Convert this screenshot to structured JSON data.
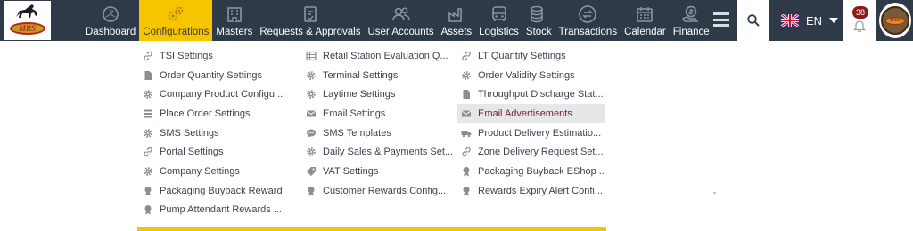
{
  "brand": {
    "logo_text": "MRS"
  },
  "nav": {
    "items": [
      {
        "label": "Dashboard",
        "icon": "gauge-icon",
        "active": false
      },
      {
        "label": "Configurations",
        "icon": "gears-icon",
        "active": true
      },
      {
        "label": "Masters",
        "icon": "building-icon",
        "active": false
      },
      {
        "label": "Requests & Approvals",
        "icon": "document-check-icon",
        "active": false
      },
      {
        "label": "User Accounts",
        "icon": "users-icon",
        "active": false
      },
      {
        "label": "Assets",
        "icon": "factory-icon",
        "active": false
      },
      {
        "label": "Logistics",
        "icon": "truck-icon",
        "active": false
      },
      {
        "label": "Stock",
        "icon": "coins-stack-icon",
        "active": false
      },
      {
        "label": "Transactions",
        "icon": "exchange-icon",
        "active": false
      },
      {
        "label": "Calendar",
        "icon": "calendar-icon",
        "active": false
      },
      {
        "label": "Finance",
        "icon": "money-hand-icon",
        "active": false
      }
    ]
  },
  "header": {
    "language": "EN",
    "notification_count": "38"
  },
  "colors": {
    "topbar": "#2f3a48",
    "accent": "#f6c500",
    "highlight_text": "#7a1c2a",
    "badge": "#8b1a1a"
  },
  "dropdown": {
    "columns": [
      {
        "items": [
          {
            "label": "TSI Settings",
            "icon": "link-icon"
          },
          {
            "label": "Order Quantity Settings",
            "icon": "document-icon"
          },
          {
            "label": "Company Product Configu...",
            "icon": "gear-icon"
          },
          {
            "label": "Place Order Settings",
            "icon": "list-icon"
          },
          {
            "label": "SMS Settings",
            "icon": "gear-icon"
          },
          {
            "label": "Portal Settings",
            "icon": "link-icon"
          },
          {
            "label": "Company Settings",
            "icon": "gear-icon"
          },
          {
            "label": "Packaging Buyback Reward",
            "icon": "award-icon"
          },
          {
            "label": "Pump Attendant Rewards ...",
            "icon": "award-icon"
          }
        ]
      },
      {
        "items": [
          {
            "label": "Retail Station Evaluation Q...",
            "icon": "table-icon"
          },
          {
            "label": "Terminal Settings",
            "icon": "gear-icon"
          },
          {
            "label": "Laytime Settings",
            "icon": "gear-icon"
          },
          {
            "label": "Email Settings",
            "icon": "envelope-icon"
          },
          {
            "label": "SMS Templates",
            "icon": "chat-icon"
          },
          {
            "label": "Daily Sales & Payments Set...",
            "icon": "gear-icon"
          },
          {
            "label": "VAT Settings",
            "icon": "tag-icon"
          },
          {
            "label": "Customer Rewards Config...",
            "icon": "award-icon"
          }
        ]
      },
      {
        "items": [
          {
            "label": "LT Quantity Settings",
            "icon": "link-icon"
          },
          {
            "label": "Order Validity Settings",
            "icon": "gear-icon"
          },
          {
            "label": "Throughput Discharge Stat...",
            "icon": "document-icon"
          },
          {
            "label": "Email Advertisements",
            "icon": "envelope-icon",
            "highlighted": true
          },
          {
            "label": "Product Delivery Estimatio...",
            "icon": "truck-icon"
          },
          {
            "label": "Zone Delivery Request Set...",
            "icon": "link-icon"
          },
          {
            "label": "Packaging Buyback EShop ...",
            "icon": "award-icon"
          },
          {
            "label": "Rewards Expiry Alert Confi...",
            "icon": "award-icon"
          }
        ]
      }
    ]
  }
}
